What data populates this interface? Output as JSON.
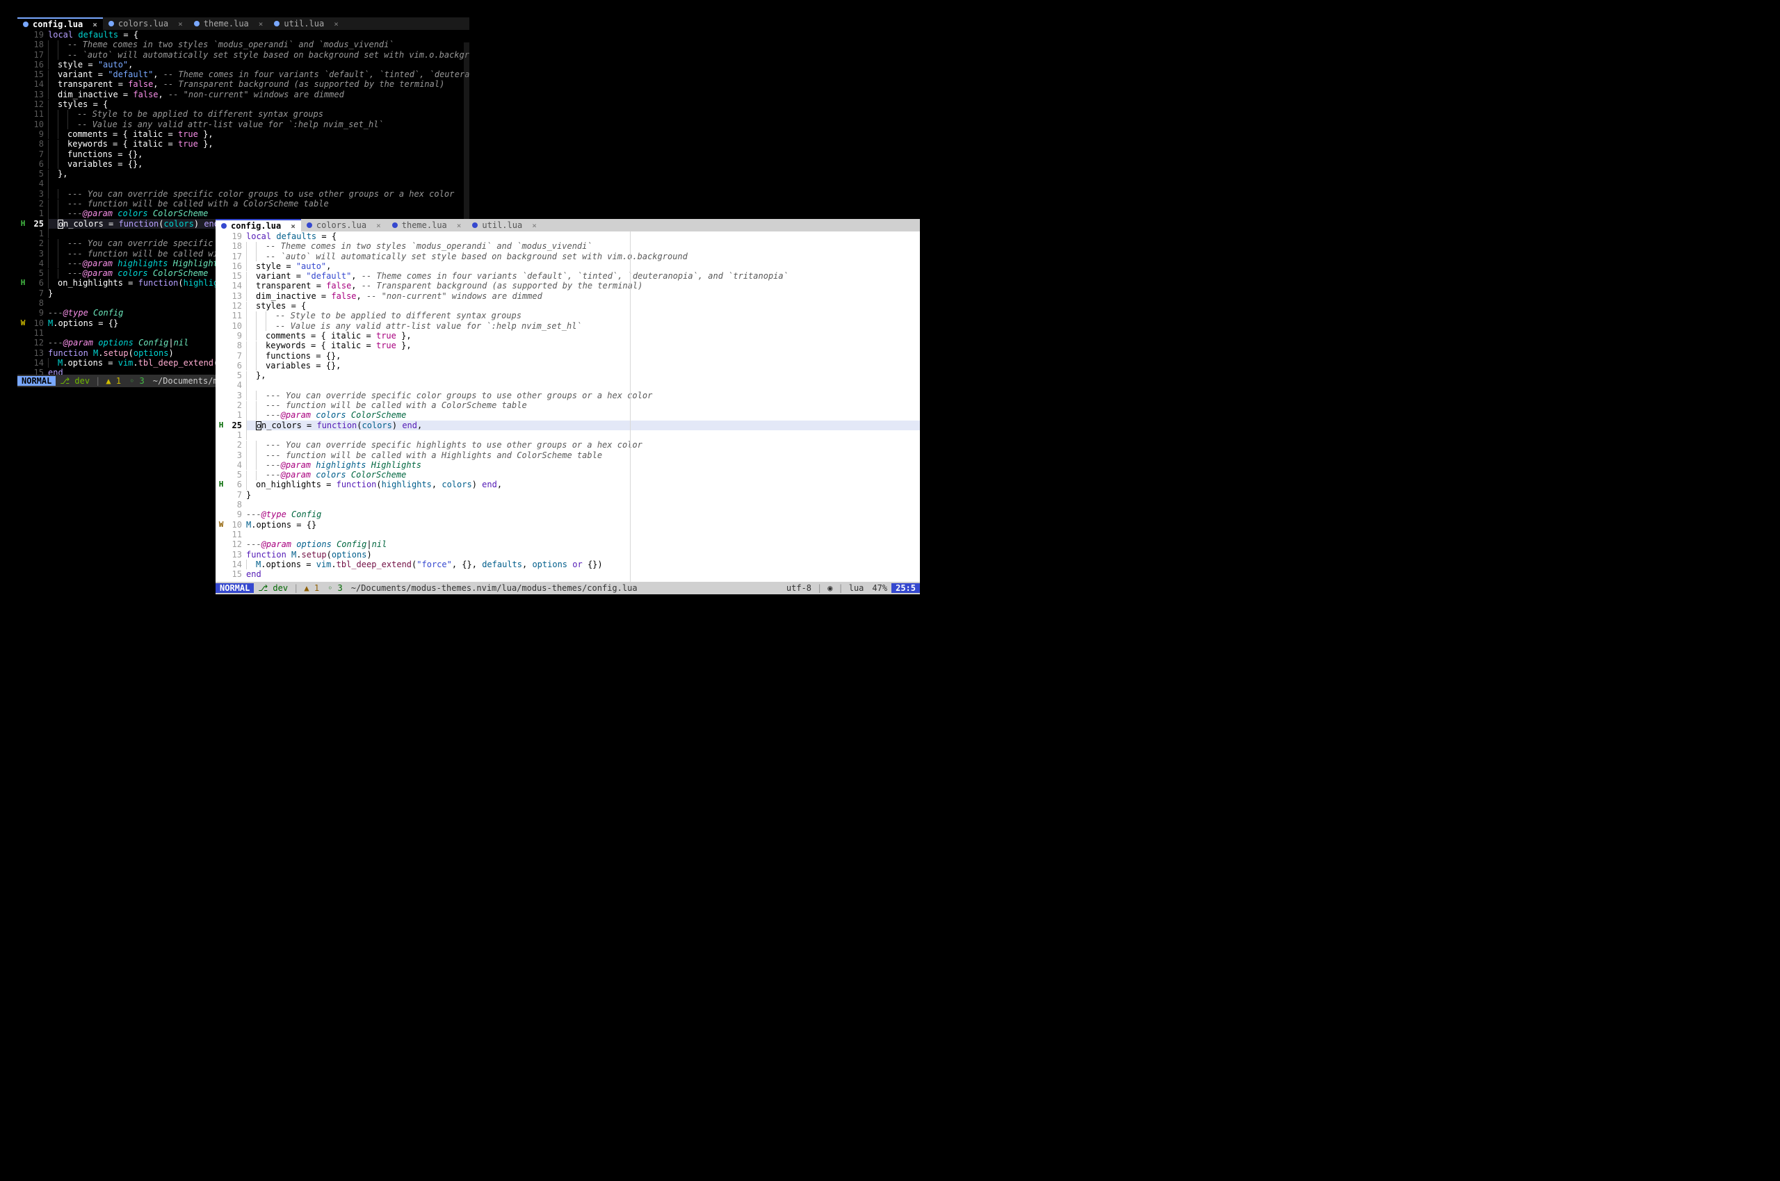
{
  "tabs": [
    {
      "label": "config.lua",
      "active": true
    },
    {
      "label": "colors.lua",
      "active": false
    },
    {
      "label": "theme.lua",
      "active": false
    },
    {
      "label": "util.lua",
      "active": false
    }
  ],
  "code_lines": [
    {
      "rel": "19",
      "sign": "",
      "tokens": [
        [
          "kw",
          "local"
        ],
        [
          "op",
          " "
        ],
        [
          "id",
          "defaults"
        ],
        [
          "op",
          " = "
        ],
        [
          "punc",
          "{"
        ]
      ]
    },
    {
      "rel": "18",
      "sign": "",
      "indent": 2,
      "tokens": [
        [
          "cmt",
          "-- Theme comes in two styles `modus_operandi` and `modus_vivendi`"
        ]
      ]
    },
    {
      "rel": "17",
      "sign": "",
      "indent": 2,
      "tokens": [
        [
          "cmt",
          "-- `auto` will automatically set style based on background set with vim.o.background"
        ]
      ]
    },
    {
      "rel": "16",
      "sign": "",
      "indent": 1,
      "tokens": [
        [
          "prop",
          "style"
        ],
        [
          "op",
          " = "
        ],
        [
          "str",
          "\"auto\""
        ],
        [
          "punc",
          ","
        ]
      ]
    },
    {
      "rel": "15",
      "sign": "",
      "indent": 1,
      "tokens": [
        [
          "prop",
          "variant"
        ],
        [
          "op",
          " = "
        ],
        [
          "str",
          "\"default\""
        ],
        [
          "punc",
          ", "
        ],
        [
          "cmt",
          "-- Theme comes in four variants `default`, `tinted`, `deuteranopia`, and `tritanopia`"
        ]
      ]
    },
    {
      "rel": "14",
      "sign": "",
      "indent": 1,
      "tokens": [
        [
          "prop",
          "transparent"
        ],
        [
          "op",
          " = "
        ],
        [
          "bool",
          "false"
        ],
        [
          "punc",
          ", "
        ],
        [
          "cmt",
          "-- Transparent background (as supported by the terminal)"
        ]
      ]
    },
    {
      "rel": "13",
      "sign": "",
      "indent": 1,
      "tokens": [
        [
          "prop",
          "dim_inactive"
        ],
        [
          "op",
          " = "
        ],
        [
          "bool",
          "false"
        ],
        [
          "punc",
          ", "
        ],
        [
          "cmt",
          "-- \"non-current\" windows are dimmed"
        ]
      ]
    },
    {
      "rel": "12",
      "sign": "",
      "indent": 1,
      "tokens": [
        [
          "prop",
          "styles"
        ],
        [
          "op",
          " = "
        ],
        [
          "punc",
          "{"
        ]
      ]
    },
    {
      "rel": "11",
      "sign": "",
      "indent": 3,
      "tokens": [
        [
          "cmt",
          "-- Style to be applied to different syntax groups"
        ]
      ]
    },
    {
      "rel": "10",
      "sign": "",
      "indent": 3,
      "tokens": [
        [
          "cmt",
          "-- Value is any valid attr-list value for `:help nvim_set_hl`"
        ]
      ]
    },
    {
      "rel": "9",
      "sign": "",
      "indent": 2,
      "tokens": [
        [
          "prop",
          "comments"
        ],
        [
          "op",
          " = "
        ],
        [
          "punc",
          "{ "
        ],
        [
          "prop",
          "italic"
        ],
        [
          "op",
          " = "
        ],
        [
          "bool",
          "true"
        ],
        [
          "punc",
          " },"
        ]
      ]
    },
    {
      "rel": "8",
      "sign": "",
      "indent": 2,
      "tokens": [
        [
          "prop",
          "keywords"
        ],
        [
          "op",
          " = "
        ],
        [
          "punc",
          "{ "
        ],
        [
          "prop",
          "italic"
        ],
        [
          "op",
          " = "
        ],
        [
          "bool",
          "true"
        ],
        [
          "punc",
          " },"
        ]
      ]
    },
    {
      "rel": "7",
      "sign": "",
      "indent": 2,
      "tokens": [
        [
          "prop",
          "functions"
        ],
        [
          "op",
          " = "
        ],
        [
          "punc",
          "{},"
        ]
      ]
    },
    {
      "rel": "6",
      "sign": "",
      "indent": 2,
      "tokens": [
        [
          "prop",
          "variables"
        ],
        [
          "op",
          " = "
        ],
        [
          "punc",
          "{},"
        ]
      ]
    },
    {
      "rel": "5",
      "sign": "",
      "indent": 1,
      "tokens": [
        [
          "punc",
          "},"
        ]
      ]
    },
    {
      "rel": "4",
      "sign": "",
      "indent": 1,
      "tokens": []
    },
    {
      "rel": "3",
      "sign": "",
      "indent": 2,
      "tokens": [
        [
          "cmt",
          "--- You can override specific color groups to use other groups or a hex color"
        ]
      ]
    },
    {
      "rel": "2",
      "sign": "",
      "indent": 2,
      "tokens": [
        [
          "cmt",
          "--- function will be called with a ColorScheme table"
        ]
      ]
    },
    {
      "rel": "1",
      "sign": "",
      "indent": 2,
      "tokens": [
        [
          "doctag",
          "---"
        ],
        [
          "doc",
          "@param "
        ],
        [
          "param",
          "colors "
        ],
        [
          "typ",
          "ColorScheme"
        ]
      ]
    },
    {
      "rel": "25",
      "sign": "H",
      "current": true,
      "indent": 1,
      "cursor": true,
      "tokens": [
        [
          "prop",
          "n_colors"
        ],
        [
          "op",
          " = "
        ],
        [
          "kw",
          "function"
        ],
        [
          "punc",
          "("
        ],
        [
          "id",
          "colors"
        ],
        [
          "punc",
          ") "
        ],
        [
          "kw",
          "end"
        ],
        [
          "punc",
          ","
        ]
      ]
    },
    {
      "rel": "1",
      "sign": "",
      "indent": 1,
      "tokens": []
    },
    {
      "rel": "2",
      "sign": "",
      "indent": 2,
      "tokens": [
        [
          "cmt",
          "--- You can override specific highlights to use other groups or a hex color"
        ]
      ]
    },
    {
      "rel": "3",
      "sign": "",
      "indent": 2,
      "tokens": [
        [
          "cmt",
          "--- function will be called with a Highlights and ColorScheme table"
        ]
      ]
    },
    {
      "rel": "4",
      "sign": "",
      "indent": 2,
      "tokens": [
        [
          "doctag",
          "---"
        ],
        [
          "doc",
          "@param "
        ],
        [
          "param",
          "highlights "
        ],
        [
          "typ",
          "Highlights"
        ]
      ]
    },
    {
      "rel": "5",
      "sign": "",
      "indent": 2,
      "tokens": [
        [
          "doctag",
          "---"
        ],
        [
          "doc",
          "@param "
        ],
        [
          "param",
          "colors "
        ],
        [
          "typ",
          "ColorScheme"
        ]
      ]
    },
    {
      "rel": "6",
      "sign": "H",
      "indent": 1,
      "tokens": [
        [
          "prop",
          "on_highlights"
        ],
        [
          "op",
          " = "
        ],
        [
          "kw",
          "function"
        ],
        [
          "punc",
          "("
        ],
        [
          "id",
          "highlights"
        ],
        [
          "punc",
          ", "
        ],
        [
          "id",
          "colors"
        ],
        [
          "punc",
          ") "
        ],
        [
          "kw",
          "end"
        ],
        [
          "punc",
          ","
        ]
      ]
    },
    {
      "rel": "7",
      "sign": "",
      "tokens": [
        [
          "punc",
          "}"
        ]
      ]
    },
    {
      "rel": "8",
      "sign": "",
      "tokens": []
    },
    {
      "rel": "9",
      "sign": "",
      "tokens": [
        [
          "doctag",
          "---"
        ],
        [
          "doc",
          "@type "
        ],
        [
          "typ",
          "Config"
        ]
      ]
    },
    {
      "rel": "10",
      "sign": "W",
      "tokens": [
        [
          "id",
          "M"
        ],
        [
          "punc",
          "."
        ],
        [
          "prop",
          "options"
        ],
        [
          "op",
          " = "
        ],
        [
          "punc",
          "{}"
        ]
      ]
    },
    {
      "rel": "11",
      "sign": "",
      "tokens": []
    },
    {
      "rel": "12",
      "sign": "",
      "tokens": [
        [
          "doctag",
          "---"
        ],
        [
          "doc",
          "@param "
        ],
        [
          "param",
          "options "
        ],
        [
          "typ",
          "Config"
        ],
        [
          "punc",
          "|"
        ],
        [
          "typ",
          "nil"
        ]
      ]
    },
    {
      "rel": "13",
      "sign": "",
      "tokens": [
        [
          "kw",
          "function"
        ],
        [
          "op",
          " "
        ],
        [
          "id",
          "M"
        ],
        [
          "punc",
          "."
        ],
        [
          "fn",
          "setup"
        ],
        [
          "punc",
          "("
        ],
        [
          "id",
          "options"
        ],
        [
          "punc",
          ")"
        ]
      ]
    },
    {
      "rel": "14",
      "sign": "",
      "indent": 1,
      "tokens": [
        [
          "id",
          "M"
        ],
        [
          "punc",
          "."
        ],
        [
          "prop",
          "options"
        ],
        [
          "op",
          " = "
        ],
        [
          "id",
          "vim"
        ],
        [
          "punc",
          "."
        ],
        [
          "fn",
          "tbl_deep_extend"
        ],
        [
          "punc",
          "("
        ],
        [
          "str",
          "\"force\""
        ],
        [
          "punc",
          ", {}, "
        ],
        [
          "id",
          "defaults"
        ],
        [
          "punc",
          ", "
        ],
        [
          "id",
          "options"
        ],
        [
          "op",
          " "
        ],
        [
          "kw",
          "or"
        ],
        [
          "op",
          " "
        ],
        [
          "punc",
          "{})"
        ]
      ]
    },
    {
      "rel": "15",
      "sign": "",
      "tokens": [
        [
          "kw",
          "end"
        ]
      ]
    }
  ],
  "statusline": {
    "mode": "NORMAL",
    "branch_icon": "⎇",
    "branch": "dev",
    "diag_w_icon": "▲",
    "diag_w": "1",
    "diag_h_icon": "◦",
    "diag_h": "3",
    "path_short": "~/Documents/mod",
    "path_full": "~/Documents/modus-themes.nvim/lua/modus-themes/config.lua",
    "encoding": "utf-8",
    "ft_icon": "◉",
    "ft": "lua",
    "percent": "47%",
    "pos": "25:5"
  }
}
